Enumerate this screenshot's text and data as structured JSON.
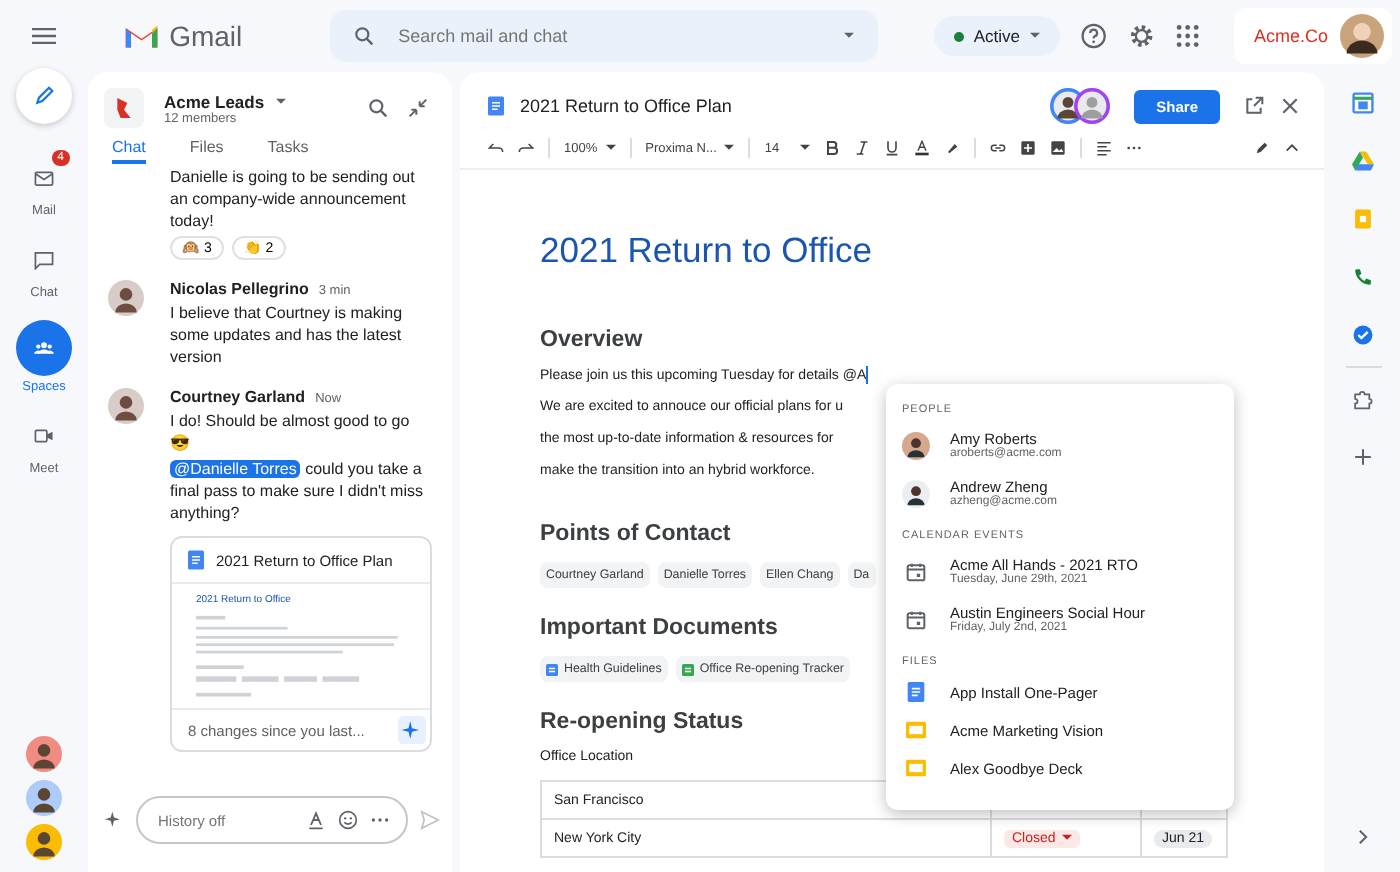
{
  "app": {
    "name": "Gmail"
  },
  "search": {
    "placeholder": "Search mail and chat"
  },
  "status": {
    "label": "Active"
  },
  "account": {
    "org": "Acme.Co"
  },
  "nav": [
    {
      "kind": "mail",
      "label": "Mail",
      "badge": "4",
      "selected": false
    },
    {
      "kind": "chat",
      "label": "Chat",
      "selected": false
    },
    {
      "kind": "spaces",
      "label": "Spaces",
      "selected": true
    },
    {
      "kind": "meet",
      "label": "Meet",
      "selected": false
    }
  ],
  "space": {
    "name": "Acme Leads",
    "members": "12 members",
    "tabs": [
      {
        "label": "Chat",
        "selected": true
      },
      {
        "label": "Files",
        "selected": false
      },
      {
        "label": "Tasks",
        "selected": false
      }
    ],
    "messages": [
      {
        "text": "Danielle is going to be sending out an company-wide announcement today!",
        "reactions": [
          {
            "emoji": "🙉",
            "count": "3"
          },
          {
            "emoji": "👏",
            "count": "2"
          }
        ]
      },
      {
        "author": "Nicolas Pellegrino",
        "time": "3 min",
        "text": "I believe that Courtney is making some updates and has the latest version"
      },
      {
        "author": "Courtney Garland",
        "time": "Now",
        "text": "I do! Should be almost good to go 😎",
        "mention": "@Danielle Torres",
        "text_after": "could you take a final pass to make sure I didn't miss anything?",
        "attachment": {
          "title": "2021 Return to Office Plan",
          "preview_title": "2021 Return to Office",
          "footer": "8 changes since you last..."
        }
      }
    ],
    "input": {
      "placeholder": "History off"
    }
  },
  "doc": {
    "title": "2021 Return to Office Plan",
    "toolbar": {
      "zoom": "100%",
      "font": "Proxima N...",
      "size": "14"
    },
    "share": "Share",
    "heading": "2021 Return to Office",
    "overview": {
      "title": "Overview",
      "lines": [
        "Please join us this upcoming Tuesday for details @A",
        "We are excited to annouce our official plans for u",
        "the most up-to-date information & resources for",
        "make the transition into an hybrid workforce."
      ]
    },
    "contacts": {
      "title": "Points of Contact",
      "chips": [
        "Courtney Garland",
        "Danielle Torres",
        "Ellen Chang",
        "Da"
      ]
    },
    "documents": {
      "title": "Important Documents",
      "chips": [
        {
          "kind": "doc",
          "label": "Health Guidelines"
        },
        {
          "kind": "sheet",
          "label": "Office Re-opening Tracker"
        }
      ]
    },
    "status": {
      "title": "Re-opening Status",
      "label": "Office Location",
      "rows": [
        {
          "location": "San Francisco"
        },
        {
          "location": "New York City",
          "state": "Closed",
          "date": "Jun 21"
        }
      ]
    }
  },
  "mentions": [
    {
      "heading": "PEOPLE",
      "items": [
        {
          "kind": "person",
          "title": "Amy Roberts",
          "subtitle": "aroberts@acme.com"
        },
        {
          "kind": "person",
          "title": "Andrew Zheng",
          "subtitle": "azheng@acme.com"
        }
      ]
    },
    {
      "heading": "CALENDAR EVENTS",
      "items": [
        {
          "kind": "event",
          "title": "Acme All Hands - 2021 RTO",
          "subtitle": "Tuesday, June 29th, 2021"
        },
        {
          "kind": "event",
          "title": "Austin Engineers Social Hour",
          "subtitle": "Friday, July 2nd, 2021"
        }
      ]
    },
    {
      "heading": "FILES",
      "items": [
        {
          "kind": "doc",
          "title": "App Install One-Pager"
        },
        {
          "kind": "slides",
          "title": "Acme Marketing Vision"
        },
        {
          "kind": "slides",
          "title": "Alex Goodbye Deck"
        }
      ]
    }
  ]
}
